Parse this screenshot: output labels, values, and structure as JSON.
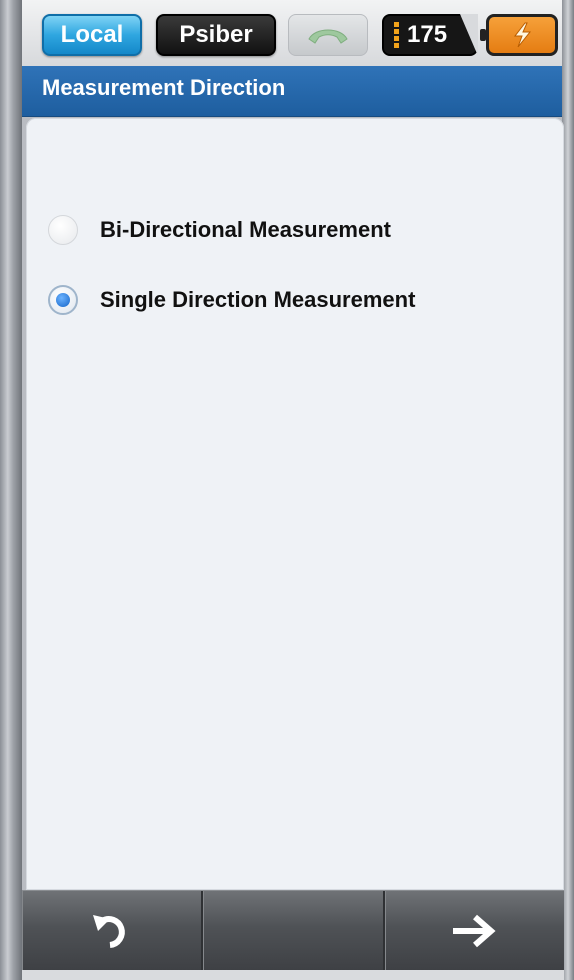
{
  "status_bar": {
    "local_label": "Local",
    "psiber_label": "Psiber",
    "phone_icon": "phone-handset-icon",
    "signal_value": "175",
    "battery_icon": "battery-charging-icon"
  },
  "header": {
    "title": "Measurement Direction"
  },
  "options": [
    {
      "label": "Bi-Directional Measurement",
      "selected": false
    },
    {
      "label": "Single Direction Measurement",
      "selected": true
    }
  ],
  "bottom_nav": {
    "back_icon": "undo-arrow-icon",
    "middle_label": "",
    "next_icon": "right-arrow-icon"
  },
  "colors": {
    "title_bar": "#1e5e9f",
    "local_button": "#2fa6e0",
    "battery": "#f08c1f",
    "radio_selected": "#1565c8",
    "content_bg": "#eff2f6"
  }
}
